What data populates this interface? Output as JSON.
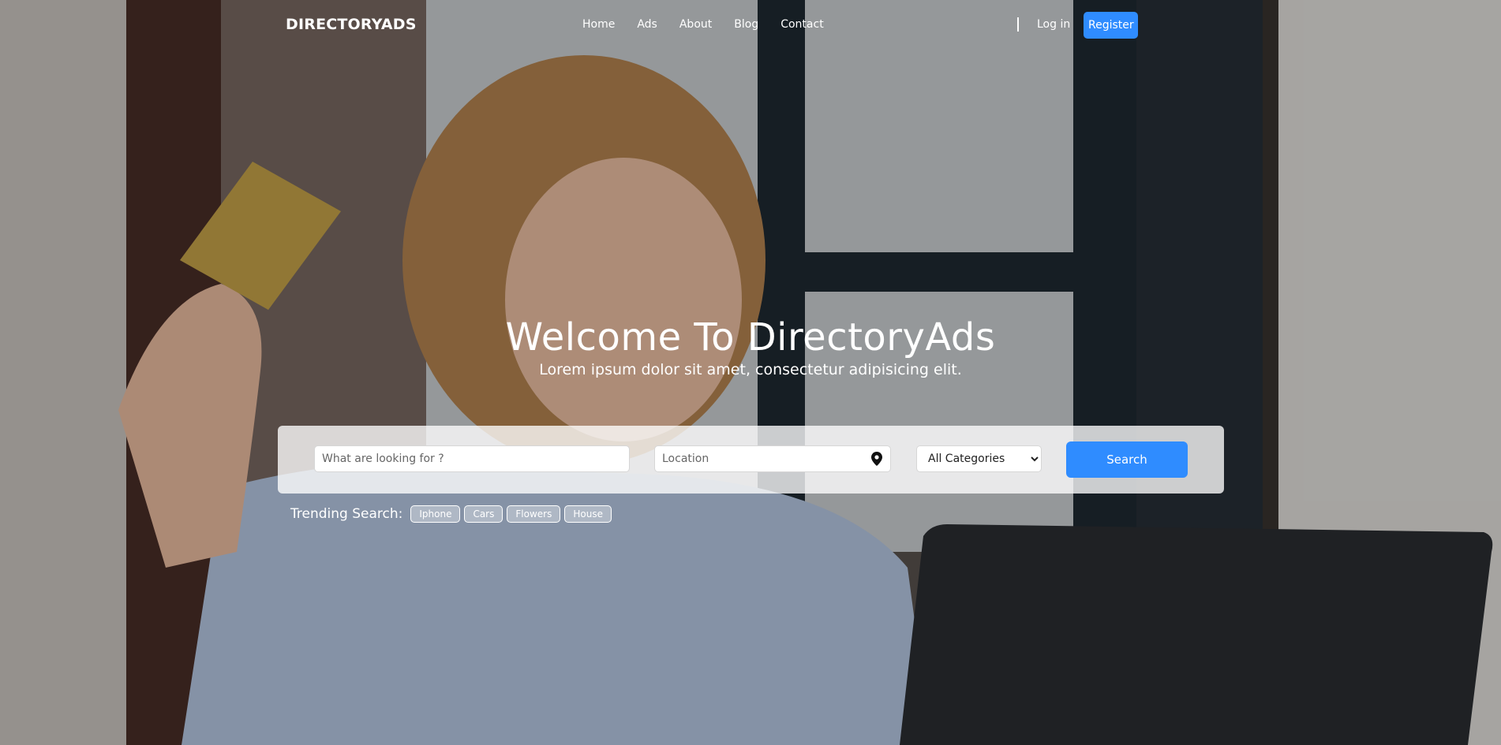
{
  "navbar": {
    "brand": "DIRECTORYADS",
    "links": [
      {
        "label": "Home"
      },
      {
        "label": "Ads"
      },
      {
        "label": "About"
      },
      {
        "label": "Blog"
      },
      {
        "label": "Contact"
      }
    ],
    "login_label": "Log in",
    "register_label": "Register"
  },
  "hero": {
    "title": "Welcome To DirectoryAds",
    "subtitle": "Lorem ipsum dolor sit amet, consectetur adipisicing elit."
  },
  "search": {
    "keyword_placeholder": "What are looking for ?",
    "keyword_value": "",
    "location_placeholder": "Location",
    "location_value": "",
    "location_icon": "map-pin-icon",
    "category_selected": "All Categories",
    "button_label": "Search"
  },
  "trending": {
    "label": "Trending Search:",
    "tags": [
      "Iphone",
      "Cars",
      "Flowers",
      "House"
    ]
  },
  "colors": {
    "accent": "#2f8cff",
    "panel": "rgba(255,255,255,0.78)",
    "text_light": "#ffffff"
  }
}
